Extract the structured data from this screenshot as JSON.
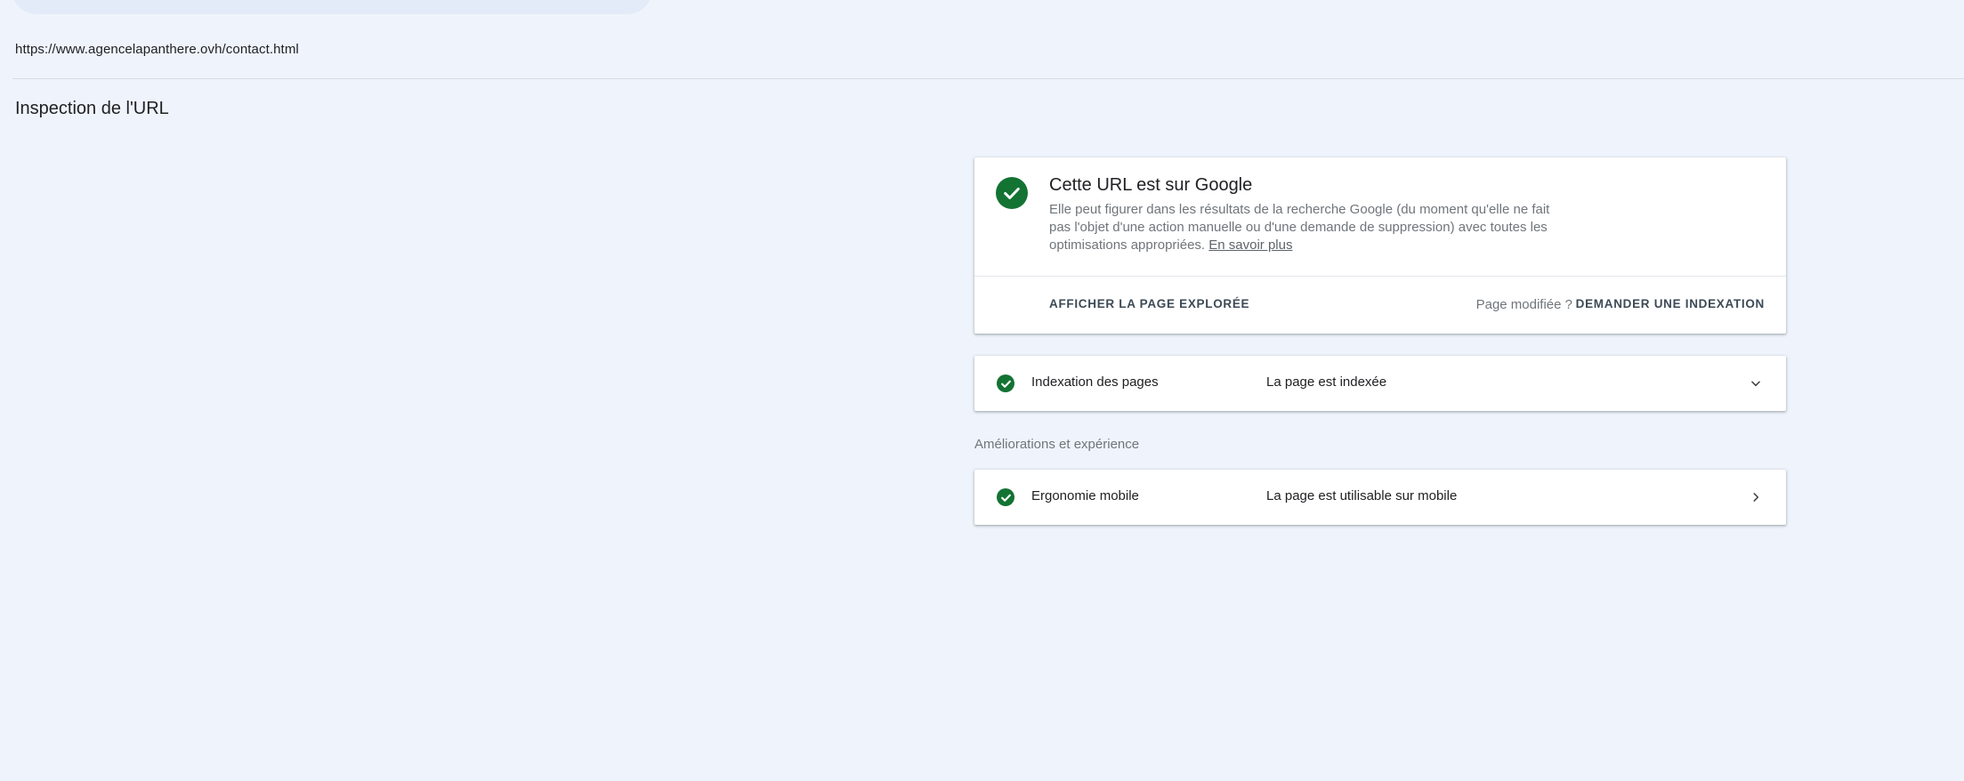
{
  "inspected_url": "https://www.agencelapanthere.ovh/contact.html",
  "page_title": "Inspection de l'URL",
  "status": {
    "title": "Cette URL est sur Google",
    "description": "Elle peut figurer dans les résultats de la recherche Google (du moment qu'elle ne fait pas l'objet d'une action manuelle ou d'une demande de suppression) avec toutes les optimisations appropriées. ",
    "learn_more": "En savoir plus",
    "view_crawled_label": "AFFICHER LA PAGE EXPLORÉE",
    "modified_label": "Page modifiée ?",
    "request_indexing_label": "DEMANDER UNE INDEXATION",
    "icon": "check-circle-icon",
    "color": "#137333"
  },
  "indexing": {
    "label": "Indexation des pages",
    "value": "La page est indexée",
    "icon": "check-circle-icon",
    "expand_icon": "chevron-down-icon"
  },
  "enhancements": {
    "section_label": "Améliorations et expérience",
    "items": [
      {
        "label": "Ergonomie mobile",
        "value": "La page est utilisable sur mobile",
        "icon": "check-circle-icon",
        "open_icon": "chevron-right-icon"
      }
    ]
  },
  "colors": {
    "background": "#eff4fc",
    "success": "#137333",
    "button_text": "#3c4a56"
  }
}
